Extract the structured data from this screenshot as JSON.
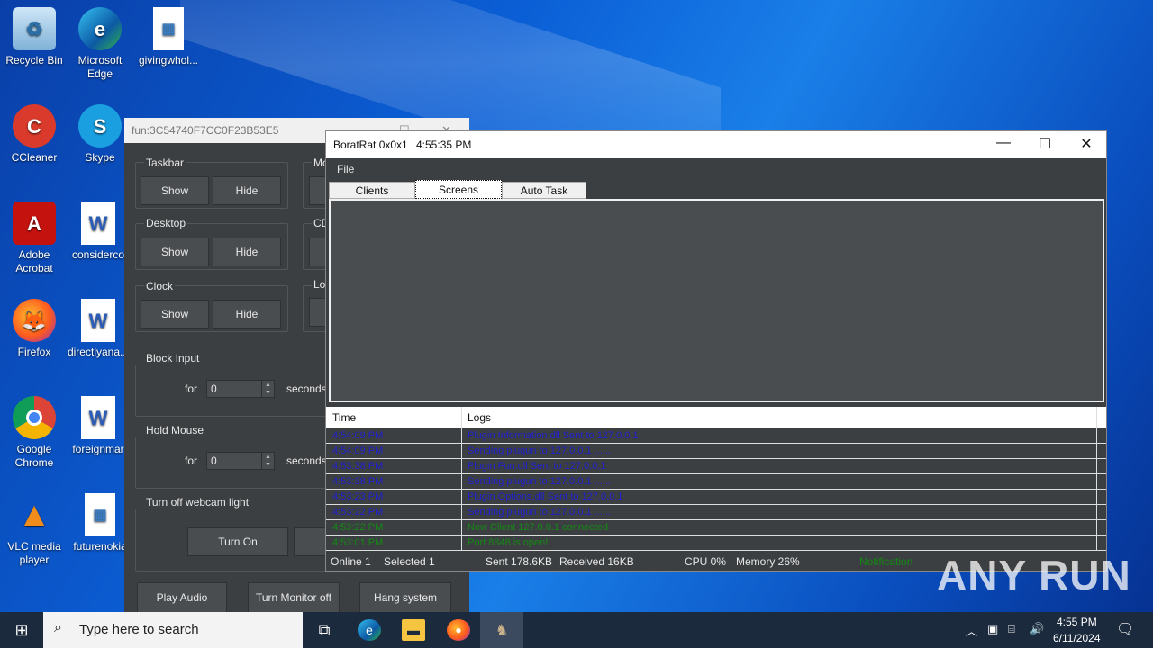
{
  "desktop": {
    "icons": [
      {
        "label": "Recycle Bin",
        "icon": "recycle-bin-icon"
      },
      {
        "label": "Microsoft Edge",
        "icon": "edge-icon"
      },
      {
        "label": "givingwhol...",
        "icon": "image-file-icon"
      },
      {
        "label": "CCleaner",
        "icon": "ccleaner-icon"
      },
      {
        "label": "Skype",
        "icon": "skype-icon"
      },
      {
        "label": "Adobe Acrobat",
        "icon": "acrobat-icon"
      },
      {
        "label": "considerco",
        "icon": "word-doc-icon"
      },
      {
        "label": "Firefox",
        "icon": "firefox-icon"
      },
      {
        "label": "directlyana...",
        "icon": "word-doc-icon"
      },
      {
        "label": "Google Chrome",
        "icon": "chrome-icon"
      },
      {
        "label": "foreignmar",
        "icon": "word-doc-icon"
      },
      {
        "label": "VLC media player",
        "icon": "vlc-icon"
      },
      {
        "label": "futurenokia",
        "icon": "image-file-icon"
      }
    ]
  },
  "fun_window": {
    "title": "fun:3C54740F7CC0F23B53E5",
    "taskbar_group": {
      "label": "Taskbar",
      "show": "Show",
      "hide": "Hide"
    },
    "desktop_group": {
      "label": "Desktop",
      "show": "Show",
      "hide": "Hide"
    },
    "clock_group": {
      "label": "Clock",
      "show": "Show",
      "hide": "Hide"
    },
    "partial_labels": {
      "mo": "Mo",
      "cd": "CD",
      "lo": "Lo"
    },
    "block_input": {
      "label": "Block Input",
      "for": "for",
      "value": "0",
      "unit": "seconds"
    },
    "hold_mouse": {
      "label": "Hold Mouse",
      "for": "for",
      "value": "0",
      "unit": "seconds"
    },
    "webcam": {
      "label": "Turn off webcam light",
      "turn_on": "Turn On"
    },
    "bottom_buttons": {
      "play_audio": "Play Audio",
      "monitor_off": "Turn Monitor off",
      "hang": "Hang system"
    }
  },
  "rat_window": {
    "title": "BoratRat 0x0x1",
    "time": "4:55:35 PM",
    "menu": {
      "file": "File"
    },
    "tabs": [
      "Clients",
      "Screens",
      "Auto Task"
    ],
    "active_tab": "Screens",
    "log_columns": {
      "time": "Time",
      "logs": "Logs"
    },
    "log_rows": [
      {
        "time": "4:54:09 PM",
        "msg": "Plugin Information.dll Sent to 127.0.0.1",
        "color": "#1f1fd0"
      },
      {
        "time": "4:54:09 PM",
        "msg": "Sending plugun to 127.0.0.1 ......",
        "color": "#1f1fd0"
      },
      {
        "time": "4:53:38 PM",
        "msg": "Plugin Fun.dll Sent to 127.0.0.1",
        "color": "#1f1fd0"
      },
      {
        "time": "4:53:38 PM",
        "msg": "Sending plugun to 127.0.0.1 ......",
        "color": "#1f1fd0"
      },
      {
        "time": "4:53:23 PM",
        "msg": "Plugin Options.dll Sent to 127.0.0.1",
        "color": "#1f1fd0"
      },
      {
        "time": "4:53:22 PM",
        "msg": "Sending plugun to 127.0.0.1 ......",
        "color": "#1f1fd0"
      },
      {
        "time": "4:53:22 PM",
        "msg": "New Client 127.0.0.1 connected",
        "color": "#138a13"
      },
      {
        "time": "4:53:01 PM",
        "msg": "Port 8848 is open!",
        "color": "#138a13"
      }
    ],
    "status": {
      "online": "Online 1",
      "selected": "Selected 1",
      "sent": "Sent 178.6KB",
      "received": "Received  16KB",
      "cpu": "CPU 0%",
      "memory": "Memory 26%",
      "notification": "Notification"
    }
  },
  "watermark": "ANY RUN",
  "taskbar": {
    "search_placeholder": "Type here to search",
    "time": "4:55 PM",
    "date": "6/11/2024"
  }
}
